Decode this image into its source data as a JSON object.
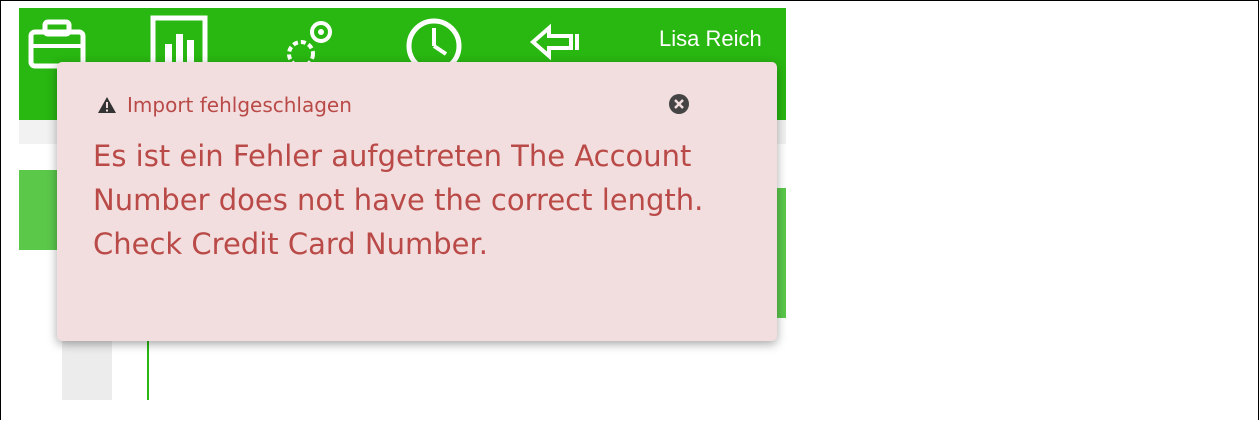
{
  "user": {
    "name": "Lisa Reich"
  },
  "toolbar": {
    "icons": [
      "briefcase-icon",
      "bar-chart-icon",
      "gears-icon",
      "clock-icon",
      "import-arrow-icon"
    ]
  },
  "notification": {
    "title": "Import fehlgeschlagen",
    "message": "Es ist ein Fehler aufgetreten The Account Number does not have the correct length. Check Credit Card Number.",
    "colors": {
      "background": "#f2dede",
      "text": "#b94a48"
    }
  },
  "theme": {
    "accent": "#29b711"
  }
}
